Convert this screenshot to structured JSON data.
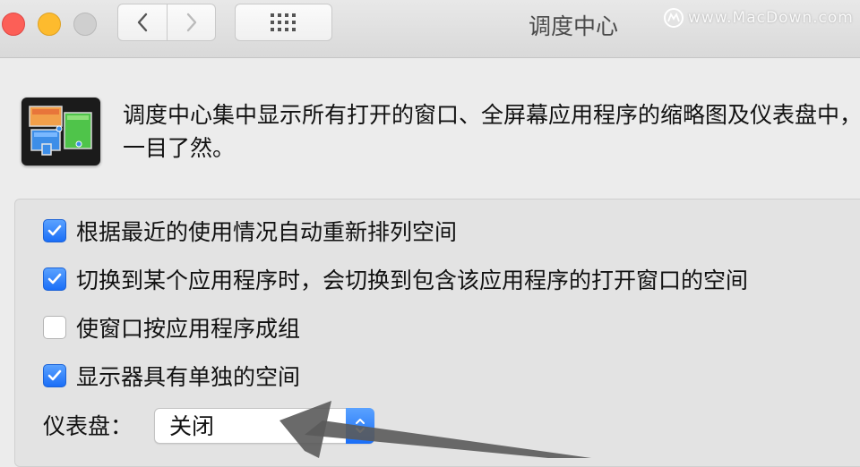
{
  "window": {
    "title": "调度中心",
    "traffic_lights": {
      "close_color": "#fc5f57",
      "minimize_color": "#fdbb2e",
      "zoom_color": "#cfcfcf"
    }
  },
  "toolbar": {
    "back_icon": "chevron-left-icon",
    "forward_icon": "chevron-right-icon",
    "show_all_icon": "grid-icon"
  },
  "watermark": {
    "text": "www.MacDown.com"
  },
  "header": {
    "description": "调度中心集中显示所有打开的窗口、全屏幕应用程序的缩略图及仪表盘中，一目了然。"
  },
  "options": [
    {
      "label": "根据最近的使用情况自动重新排列空间",
      "checked": true
    },
    {
      "label": "切换到某个应用程序时，会切换到包含该应用程序的打开窗口的空间",
      "checked": true
    },
    {
      "label": "使窗口按应用程序成组",
      "checked": false
    },
    {
      "label": "显示器具有单独的空间",
      "checked": true
    }
  ],
  "dashboard": {
    "label": "仪表盘：",
    "selected": "关闭"
  },
  "colors": {
    "accent": "#1a6ef7",
    "annotation_arrow": "#555555"
  }
}
